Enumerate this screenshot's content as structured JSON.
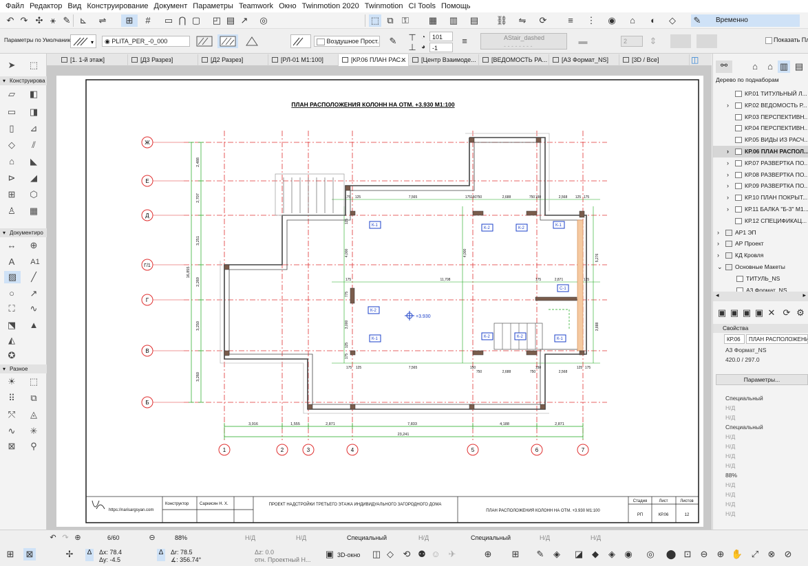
{
  "menu": [
    "Файл",
    "Редактор",
    "Вид",
    "Конструирование",
    "Документ",
    "Параметры",
    "Teamwork",
    "Окно",
    "Twinmotion 2020",
    "Twinmotion",
    "CI Tools",
    "Помощь"
  ],
  "toolbar": {
    "unlock_label": "Временно Разгруппировать",
    "defaults_label": "Параметры по Умолчанию",
    "layer_value": "PLITA_PER_-0_000",
    "air_value": "Воздушное Прост...",
    "pen_value": "101",
    "offset_value": "-1",
    "line_type": "AStair_dashed",
    "pen_num": "2",
    "show_plan": "Показать План"
  },
  "tabs": [
    {
      "label": "[1. 1-й этаж]"
    },
    {
      "label": "[Д3 Разрез]"
    },
    {
      "label": "[Д2 Разрез]"
    },
    {
      "label": "[РЛ-01 М1:100]"
    },
    {
      "label": "[КР.06 ПЛАН РАС..."
    },
    {
      "label": "[Центр Взаимоде..."
    },
    {
      "label": "[ВЕДОМОСТЬ РА..."
    },
    {
      "label": "[А3 Формат_NS]"
    },
    {
      "label": "[3D / Все]"
    }
  ],
  "left_panel": {
    "sections": [
      "Конструирова",
      "Документиро",
      "Разное"
    ],
    "tools": {
      "text_a1": "A1"
    }
  },
  "navigator": {
    "header": "Дерево по поднаборам",
    "items": [
      "КР.01 ТИТУЛЬНЫЙ Л...",
      "КР.02 ВЕДОМОСТЬ Р...",
      "КР.03 ПЕРСПЕКТИВН...",
      "КР.04 ПЕРСПЕКТИВН...",
      "КР.05 ВИДЫ ИЗ РАСЧ...",
      "КР.06 ПЛАН РАСПОЛ...",
      "КР.07 РАЗВЕРТКА ПО...",
      "КР.08 РАЗВЕРТКА ПО...",
      "КР.09 РАЗВЕРТКА ПО...",
      "КР.10 ПЛАН ПОКРЫТ...",
      "КР.11 БАЛКА \"Б-3\" М1...",
      "КР.12 СПЕЦИФИКАЦ...",
      "АР1 ЭП",
      "АР Проект",
      "КД Кровля",
      "Основные Макеты",
      "ТИТУЛЬ_NS",
      "А3 Формат_NS"
    ],
    "selected": 5
  },
  "properties": {
    "header": "Свойства",
    "id": "КР.06",
    "name": "ПЛАН РАСПОЛОЖЕНИЯ...",
    "master": "А3 Формат_NS",
    "size": "420.0 / 297.0",
    "params_button": "Параметры...",
    "special1": "Специальный",
    "nd": "Н/Д",
    "special2": "Специальный",
    "zoom": "88%"
  },
  "drawing": {
    "title": "ПЛАН РАСПОЛОЖЕНИЯ КОЛОНН НА ОТМ. +3.930  М1:100",
    "level_mark": "+3.930",
    "row_axes": [
      "Ж",
      "Е",
      "Д",
      "Г/1",
      "Г",
      "В",
      "Б"
    ],
    "col_axes": [
      "1",
      "2",
      "3",
      "4",
      "5",
      "6",
      "7"
    ],
    "left_dims": [
      "2,488",
      "2,707",
      "3,251",
      "2,269",
      "3,250",
      "3,260"
    ],
    "left_total": "16,855",
    "bottom_dims": [
      "3,916",
      "1,555",
      "2,871",
      "7,833",
      "4,188",
      "2,871"
    ],
    "bottom_total": "23,241",
    "top_dims": [
      "175",
      "125",
      "7,565",
      "175",
      "150",
      "750",
      "2,688",
      "750",
      "150",
      "2,568",
      "125",
      "175"
    ],
    "mid_dims": [
      "175",
      "11,708",
      "175",
      "2,871",
      "125"
    ],
    "low_dims": [
      "175",
      "125",
      "7,565",
      "150",
      "750",
      "2,688",
      "750",
      "150",
      "2,568",
      "125",
      "175"
    ],
    "right_dims": [
      "5,276",
      "3,888"
    ],
    "inner_dims": [
      "4,000",
      "3,000",
      "775",
      "125",
      "125",
      "175"
    ],
    "columns": [
      "К-1",
      "К-2",
      "К-2",
      "К-1",
      "К-2",
      "С-1",
      "К-1",
      "К-2",
      "К-2",
      "К-1"
    ]
  },
  "title_block": {
    "site": "https://narisargsyan.com",
    "role": "Конструктор",
    "person": "Саркисян Н. Х.",
    "project": "ПРОЕКТ НАДСТРОЙКИ ТРЕТЬЕГО ЭТАЖА ИНДИВИДУАЛЬНОГО ЗАГОРОДНОГО ДОМА",
    "sheet_title": "ПЛАН РАСПОЛОЖЕНИЯ КОЛОНН НА ОТМ. +3.930  М1:100",
    "stage_label": "Стадия",
    "sheet_label": "Лист",
    "sheets_label": "Листов",
    "stage": "РП",
    "sheet": "КР.06",
    "sheets": "12"
  },
  "status": {
    "page": "6/60",
    "zoom": "88%",
    "nd1": "Н/Д",
    "nd2": "Н/Д",
    "special": "Специальный",
    "nd3": "Н/Д",
    "special2": "Специальный",
    "nd4": "Н/Д",
    "nd5": "Н/Д",
    "dx": "Δx: 78.4",
    "dy": "Δy: -4.5",
    "dr": "Δr: 78.5",
    "da": "∡: 356.74°",
    "dz": "Δz: 0.0",
    "ref": "отн. Проектный Н...",
    "view3d": "3D-окно"
  },
  "colors": {
    "accent": "#2a7fd4",
    "axis": "#e03030",
    "dim": "#1aa81a",
    "wall": "#555555",
    "column": "#7a5c4c",
    "mark": "#1a3fc8"
  }
}
